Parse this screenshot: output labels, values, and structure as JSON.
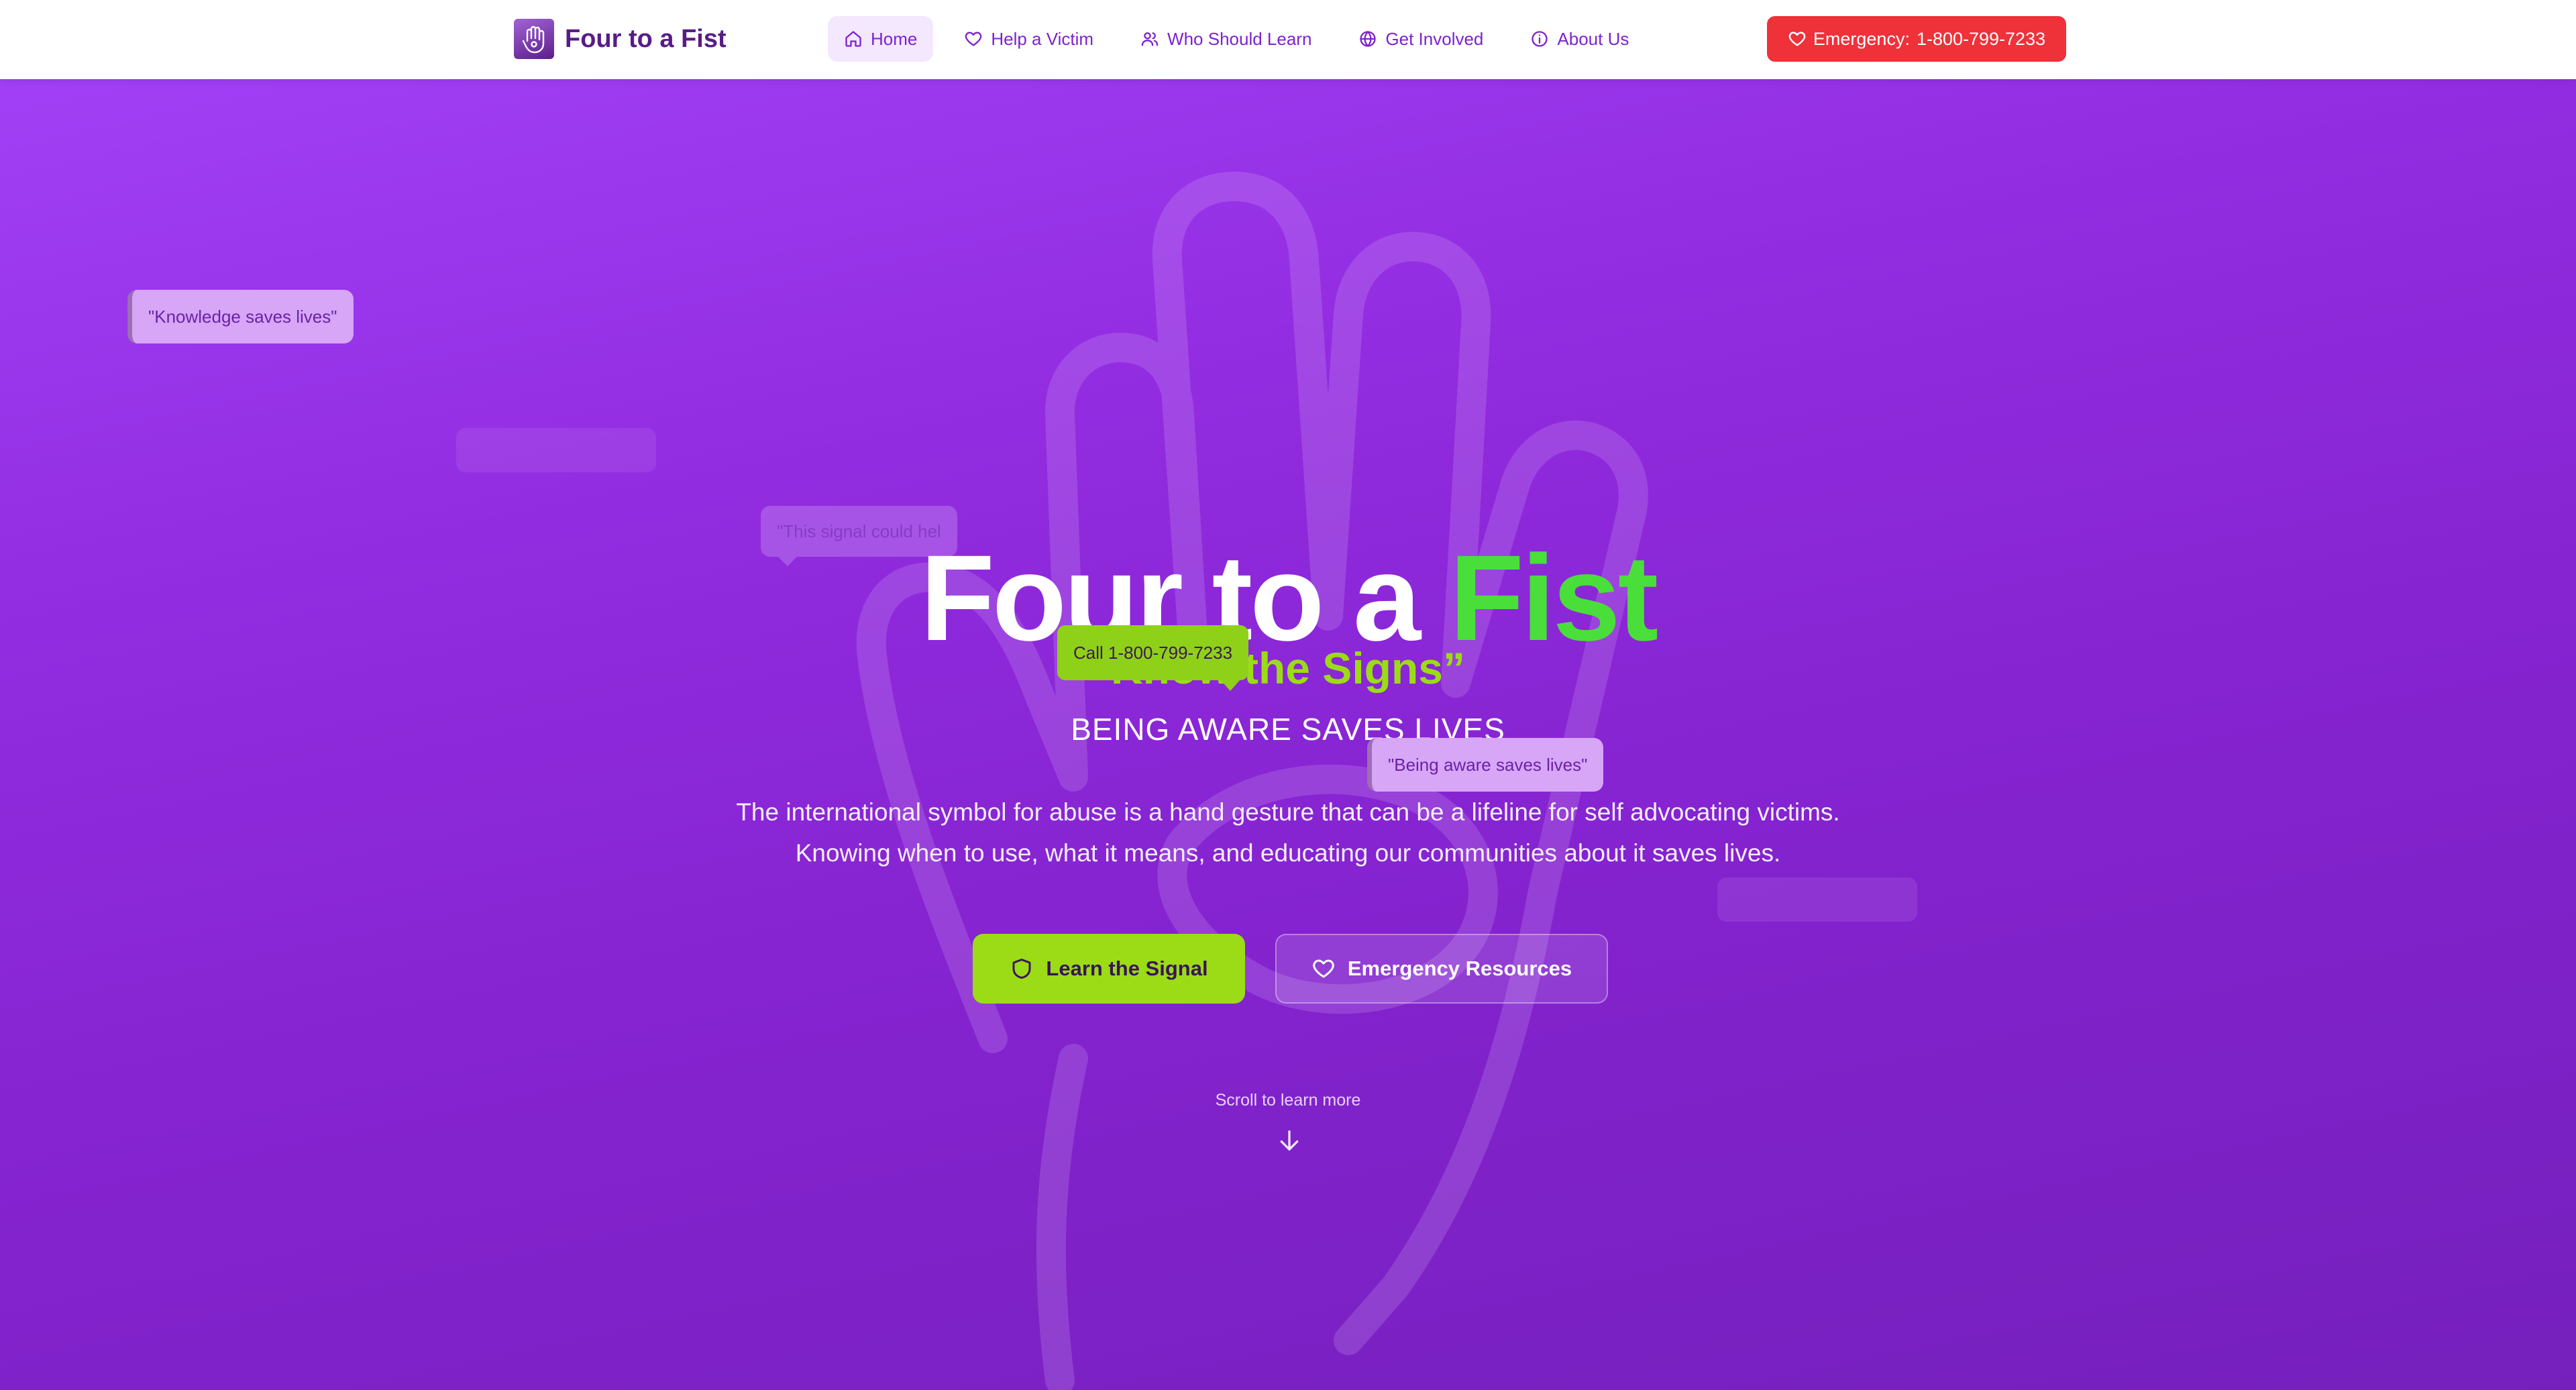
{
  "brand": {
    "name": "Four to a Fist",
    "logo": "hand-logo-icon"
  },
  "nav": {
    "items": [
      {
        "label": "Home",
        "icon": "home-icon",
        "active": true
      },
      {
        "label": "Help a Victim",
        "icon": "heart-icon"
      },
      {
        "label": "Who Should Learn",
        "icon": "users-icon"
      },
      {
        "label": "Get Involved",
        "icon": "globe-icon"
      },
      {
        "label": "About Us",
        "icon": "info-icon"
      }
    ],
    "emergency": {
      "prefix": "Emergency:",
      "number": "1-800-799-7233",
      "icon": "heart-icon"
    }
  },
  "hero": {
    "title_main": "Four to a ",
    "title_accent": "Fist",
    "tagline": "Know the Signs”",
    "subheading": "BEING AWARE SAVES LIVES",
    "description_line1": "The international symbol for abuse is a hand gesture that can be a lifeline for self advocating victims.",
    "description_line2": "Knowing when to use, what it means, and educating our communities about it saves lives.",
    "primary_button": "Learn the Signal",
    "secondary_button": "Emergency Resources",
    "scroll_hint": "Scroll to learn more",
    "background_icon": "open-hand-icon"
  },
  "bubbles": {
    "knowledge": "\"Knowledge saves lives\"",
    "signal": "\"This signal could hel",
    "call": "Call 1-800-799-7233",
    "aware": "\"Being aware saves lives\""
  },
  "colors": {
    "primary_purple": "#7e22ce",
    "accent_green": "#4ade3a",
    "lime": "#9bdc16",
    "emergency_red": "#ef3139"
  }
}
